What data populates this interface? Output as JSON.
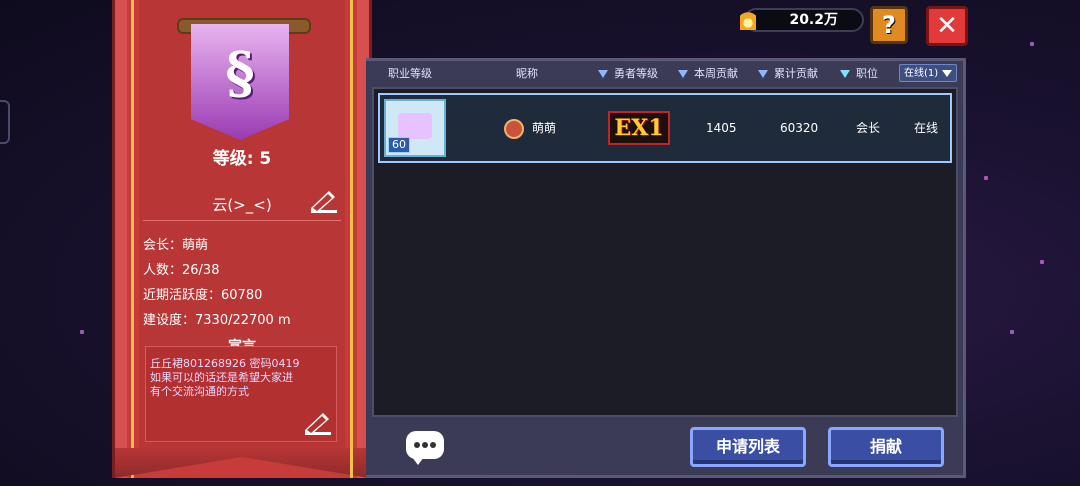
{
  "currency": {
    "amount": "20.2万",
    "icon": "flame-coin-icon"
  },
  "guild": {
    "level_text": "等级: 5",
    "name": "云(>_<)",
    "leader": "会长：萌萌",
    "members": "人数：26/38",
    "activity": "近期活跃度：60780",
    "construction": "建设度：7330/22700 m",
    "notice_title": "宣言",
    "notice_lines": [
      "丘丘裙801268926    密码0419",
      "如果可以的话还是希望大家进",
      "有个交流沟通的方式"
    ]
  },
  "table": {
    "headers": {
      "class_level": "职业等级",
      "nickname": "昵称",
      "hero_level": "勇者等级",
      "weekly": "本周贡献",
      "total": "累计贡献",
      "position": "职位",
      "filter": "在线(1)"
    },
    "rows": [
      {
        "avatar_level": "60",
        "nickname": "萌萌",
        "hero_badge": "EX1",
        "weekly": "1405",
        "total": "60320",
        "position": "会长",
        "status": "在线"
      }
    ]
  },
  "buttons": {
    "apply_list": "申请列表",
    "donate": "捐献"
  },
  "colors": {
    "banner_red": "#c73b3b",
    "panel": "#3b3b55",
    "button_blue": "#3a4ea3",
    "close_red": "#e23a3a",
    "help_orange": "#e08a22"
  }
}
